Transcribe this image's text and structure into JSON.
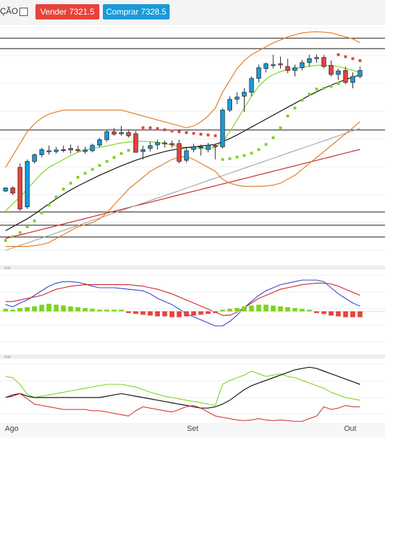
{
  "toolbar": {
    "label": "ÇÃO",
    "sell_label": "Vender 7321.5",
    "buy_label": "Comprar 7328.5"
  },
  "x_axis": {
    "labels": [
      "Ago",
      "Set",
      "Out"
    ]
  },
  "colors": {
    "sell": "#e8433b",
    "buy": "#1a9ad9",
    "bollinger": "#e07b25",
    "sma_fast": "#7ed321",
    "sma_mid": "#111111",
    "sma_slow": "#999999",
    "sma_long": "#cc2222",
    "psar_up": "#7ed321",
    "psar_down": "#e8433b",
    "macd": "#3344cc",
    "signal": "#cc2222"
  },
  "chart_data": {
    "type": "candlestick",
    "candles": [
      [
        7000,
        7010,
        6998,
        7008
      ],
      [
        7008,
        7012,
        6990,
        6995
      ],
      [
        7060,
        7070,
        6950,
        6955
      ],
      [
        6960,
        7080,
        6955,
        7075
      ],
      [
        7075,
        7095,
        7070,
        7092
      ],
      [
        7092,
        7110,
        7085,
        7105
      ],
      [
        7100,
        7115,
        7092,
        7102
      ],
      [
        7100,
        7112,
        7095,
        7104
      ],
      [
        7105,
        7115,
        7098,
        7104
      ],
      [
        7104,
        7118,
        7095,
        7108
      ],
      [
        7105,
        7115,
        7098,
        7102
      ],
      [
        7100,
        7112,
        7095,
        7104
      ],
      [
        7102,
        7120,
        7098,
        7116
      ],
      [
        7116,
        7135,
        7110,
        7130
      ],
      [
        7130,
        7155,
        7125,
        7150
      ],
      [
        7150,
        7160,
        7140,
        7144
      ],
      [
        7145,
        7165,
        7140,
        7148
      ],
      [
        7148,
        7155,
        7135,
        7140
      ],
      [
        7145,
        7152,
        7098,
        7098
      ],
      [
        7100,
        7115,
        7080,
        7105
      ],
      [
        7108,
        7125,
        7100,
        7115
      ],
      [
        7117,
        7130,
        7105,
        7123
      ],
      [
        7122,
        7128,
        7110,
        7120
      ],
      [
        7120,
        7128,
        7110,
        7118
      ],
      [
        7120,
        7130,
        7070,
        7075
      ],
      [
        7078,
        7112,
        7072,
        7102
      ],
      [
        7105,
        7120,
        7098,
        7112
      ],
      [
        7110,
        7118,
        7090,
        7112
      ],
      [
        7105,
        7122,
        7098,
        7116
      ],
      [
        7115,
        7120,
        7080,
        7113
      ],
      [
        7112,
        7210,
        7108,
        7205
      ],
      [
        7205,
        7240,
        7200,
        7232
      ],
      [
        7232,
        7250,
        7220,
        7238
      ],
      [
        7240,
        7260,
        7200,
        7250
      ],
      [
        7250,
        7290,
        7240,
        7285
      ],
      [
        7285,
        7320,
        7275,
        7312
      ],
      [
        7310,
        7325,
        7300,
        7322
      ],
      [
        7320,
        7345,
        7310,
        7320
      ],
      [
        7322,
        7340,
        7310,
        7320
      ],
      [
        7315,
        7335,
        7298,
        7305
      ],
      [
        7305,
        7320,
        7290,
        7312
      ],
      [
        7312,
        7332,
        7305,
        7325
      ],
      [
        7325,
        7345,
        7315,
        7335
      ],
      [
        7335,
        7345,
        7325,
        7338
      ],
      [
        7338,
        7345,
        7310,
        7315
      ],
      [
        7318,
        7330,
        7290,
        7295
      ],
      [
        7295,
        7310,
        7280,
        7304
      ],
      [
        7305,
        7315,
        7270,
        7275
      ],
      [
        7275,
        7300,
        7260,
        7290
      ],
      [
        7290,
        7315,
        7285,
        7305
      ]
    ],
    "bollinger_upper": [
      7060,
      7090,
      7120,
      7150,
      7170,
      7185,
      7195,
      7200,
      7205,
      7205,
      7205,
      7205,
      7205,
      7205,
      7205,
      7205,
      7205,
      7200,
      7195,
      7190,
      7185,
      7180,
      7175,
      7170,
      7165,
      7160,
      7165,
      7175,
      7190,
      7210,
      7250,
      7280,
      7310,
      7330,
      7345,
      7355,
      7365,
      7375,
      7382,
      7390,
      7395,
      7400,
      7402,
      7403,
      7402,
      7400,
      7395,
      7390,
      7385,
      7375
    ],
    "bollinger_middle": [
      6960,
      6975,
      6990,
      7005,
      7020,
      7035,
      7050,
      7062,
      7072,
      7080,
      7087,
      7093,
      7098,
      7103,
      7108,
      7113,
      7117,
      7120,
      7122,
      7124,
      7126,
      7128,
      7129,
      7129,
      7128,
      7126,
      7125,
      7125,
      7126,
      7128,
      7140,
      7155,
      7172,
      7190,
      7208,
      7226,
      7243,
      7260,
      7275,
      7288,
      7298,
      7306,
      7312,
      7316,
      7318,
      7318,
      7316,
      7312,
      7307,
      7300
    ],
    "bollinger_lower": [
      6860,
      6860,
      6860,
      6860,
      6862,
      6865,
      6870,
      6880,
      6890,
      6900,
      6910,
      6915,
      6920,
      6930,
      6945,
      6965,
      6985,
      7005,
      7020,
      7035,
      7050,
      7060,
      7070,
      7080,
      7085,
      7088,
      7080,
      7070,
      7060,
      7050,
      7030,
      7020,
      7015,
      7012,
      7012,
      7012,
      7013,
      7015,
      7020,
      7030,
      7040,
      7055,
      7070,
      7085,
      7100,
      7115,
      7130,
      7145,
      7160,
      7175
    ],
    "sma_fast": [
      6950,
      6968,
      6985,
      7005,
      7025,
      7045,
      7060,
      7070,
      7080,
      7090,
      7098,
      7104,
      7108,
      7111,
      7114,
      7118,
      7122,
      7124,
      7126,
      7126,
      7125,
      7123,
      7120,
      7117,
      7113,
      7110,
      7109,
      7108,
      7108,
      7110,
      7125,
      7150,
      7180,
      7210,
      7240,
      7265,
      7283,
      7295,
      7302,
      7307,
      7310,
      7313,
      7316,
      7318,
      7318,
      7317,
      7315,
      7310,
      7305,
      7300
    ],
    "sma_mid": [
      6900,
      6910,
      6920,
      6930,
      6942,
      6955,
      6968,
      6980,
      6992,
      7003,
      7013,
      7022,
      7031,
      7040,
      7048,
      7056,
      7064,
      7071,
      7078,
      7084,
      7090,
      7095,
      7100,
      7104,
      7107,
      7110,
      7112,
      7114,
      7116,
      7118,
      7125,
      7133,
      7142,
      7152,
      7162,
      7172,
      7182,
      7192,
      7202,
      7212,
      7222,
      7232,
      7242,
      7251,
      7260,
      7268,
      7275,
      7282,
      7288,
      7294
    ],
    "psar": [
      [
        1,
        6875,
        "up"
      ],
      [
        2,
        6885,
        "up"
      ],
      [
        3,
        6895,
        "up"
      ],
      [
        4,
        6910,
        "up"
      ],
      [
        5,
        6925,
        "up"
      ],
      [
        6,
        6945,
        "up"
      ],
      [
        7,
        6965,
        "up"
      ],
      [
        8,
        6985,
        "up"
      ],
      [
        9,
        7005,
        "up"
      ],
      [
        10,
        7020,
        "up"
      ],
      [
        11,
        7035,
        "up"
      ],
      [
        12,
        7045,
        "up"
      ],
      [
        13,
        7055,
        "up"
      ],
      [
        14,
        7065,
        "up"
      ],
      [
        15,
        7075,
        "up"
      ],
      [
        16,
        7085,
        "up"
      ],
      [
        17,
        7095,
        "up"
      ],
      [
        18,
        7103,
        "up"
      ],
      [
        19,
        7110,
        "up"
      ],
      [
        20,
        7160,
        "down"
      ],
      [
        21,
        7160,
        "down"
      ],
      [
        22,
        7158,
        "down"
      ],
      [
        23,
        7155,
        "down"
      ],
      [
        24,
        7152,
        "down"
      ],
      [
        25,
        7150,
        "down"
      ],
      [
        26,
        7148,
        "down"
      ],
      [
        27,
        7146,
        "down"
      ],
      [
        28,
        7144,
        "down"
      ],
      [
        29,
        7142,
        "down"
      ],
      [
        30,
        7140,
        "down"
      ],
      [
        31,
        7080,
        "up"
      ],
      [
        32,
        7082,
        "up"
      ],
      [
        33,
        7086,
        "up"
      ],
      [
        34,
        7090,
        "up"
      ],
      [
        35,
        7096,
        "up"
      ],
      [
        36,
        7105,
        "up"
      ],
      [
        37,
        7118,
        "up"
      ],
      [
        38,
        7135,
        "up"
      ],
      [
        39,
        7160,
        "up"
      ],
      [
        40,
        7190,
        "up"
      ],
      [
        41,
        7210,
        "up"
      ],
      [
        42,
        7230,
        "up"
      ],
      [
        43,
        7245,
        "up"
      ],
      [
        44,
        7258,
        "up"
      ],
      [
        45,
        7260,
        "up"
      ],
      [
        46,
        7265,
        "up"
      ],
      [
        47,
        7272,
        "up"
      ]
    ],
    "psar_down_tail": [
      [
        47,
        7345
      ],
      [
        48,
        7340
      ],
      [
        49,
        7335
      ],
      [
        50,
        7330
      ]
    ],
    "macd_line": [
      58,
      55,
      60,
      64,
      70,
      76,
      82,
      86,
      88,
      88,
      87,
      85,
      82,
      80,
      80,
      80,
      79,
      78,
      77,
      76,
      72,
      66,
      62,
      58,
      52,
      46,
      42,
      38,
      34,
      30,
      30,
      36,
      44,
      54,
      62,
      70,
      76,
      80,
      84,
      86,
      88,
      90,
      90,
      90,
      88,
      80,
      72,
      66,
      60,
      56
    ],
    "signal_line": [
      62,
      62,
      64,
      66,
      68,
      70,
      74,
      78,
      80,
      82,
      83,
      84,
      84,
      84,
      84,
      84,
      84,
      84,
      83,
      82,
      80,
      78,
      75,
      72,
      68,
      64,
      60,
      56,
      52,
      48,
      44,
      44,
      48,
      54,
      60,
      66,
      70,
      74,
      78,
      80,
      82,
      84,
      85,
      86,
      86,
      85,
      82,
      78,
      74,
      70
    ],
    "histogram": [
      3,
      2,
      4,
      5,
      6,
      8,
      9,
      8,
      7,
      6,
      5,
      4,
      3,
      2,
      2,
      2,
      2,
      -2,
      -3,
      -4,
      -5,
      -6,
      -6,
      -7,
      -7,
      -6,
      -5,
      -4,
      -3,
      -2,
      2,
      3,
      4,
      6,
      7,
      8,
      8,
      7,
      6,
      5,
      4,
      3,
      2,
      -2,
      -3,
      -5,
      -6,
      -7,
      -7,
      -7
    ],
    "stoch_k": [
      72,
      70,
      60,
      45,
      40,
      42,
      44,
      46,
      48,
      50,
      52,
      54,
      56,
      58,
      60,
      60,
      60,
      58,
      56,
      52,
      48,
      45,
      42,
      40,
      38,
      36,
      34,
      32,
      30,
      28,
      60,
      66,
      70,
      74,
      80,
      76,
      72,
      74,
      76,
      72,
      70,
      66,
      62,
      58,
      54,
      48,
      44,
      40,
      38,
      36
    ],
    "stoch_d": [
      40,
      44,
      46,
      42,
      40,
      40,
      40,
      40,
      40,
      40,
      40,
      40,
      40,
      40,
      42,
      44,
      46,
      44,
      42,
      40,
      38,
      36,
      34,
      32,
      30,
      28,
      26,
      24,
      24,
      26,
      30,
      36,
      44,
      52,
      58,
      62,
      66,
      70,
      74,
      78,
      82,
      84,
      86,
      84,
      80,
      76,
      72,
      68,
      64,
      60
    ],
    "rsi": [
      40,
      42,
      46,
      38,
      30,
      28,
      26,
      24,
      22,
      22,
      22,
      22,
      20,
      20,
      18,
      16,
      14,
      12,
      20,
      26,
      24,
      22,
      20,
      18,
      22,
      26,
      28,
      24,
      18,
      12,
      10,
      8,
      6,
      5,
      6,
      8,
      6,
      5,
      6,
      5,
      4,
      4,
      8,
      12,
      26,
      22,
      24,
      28,
      26,
      26
    ],
    "ylim": [
      6840,
      7420
    ]
  }
}
